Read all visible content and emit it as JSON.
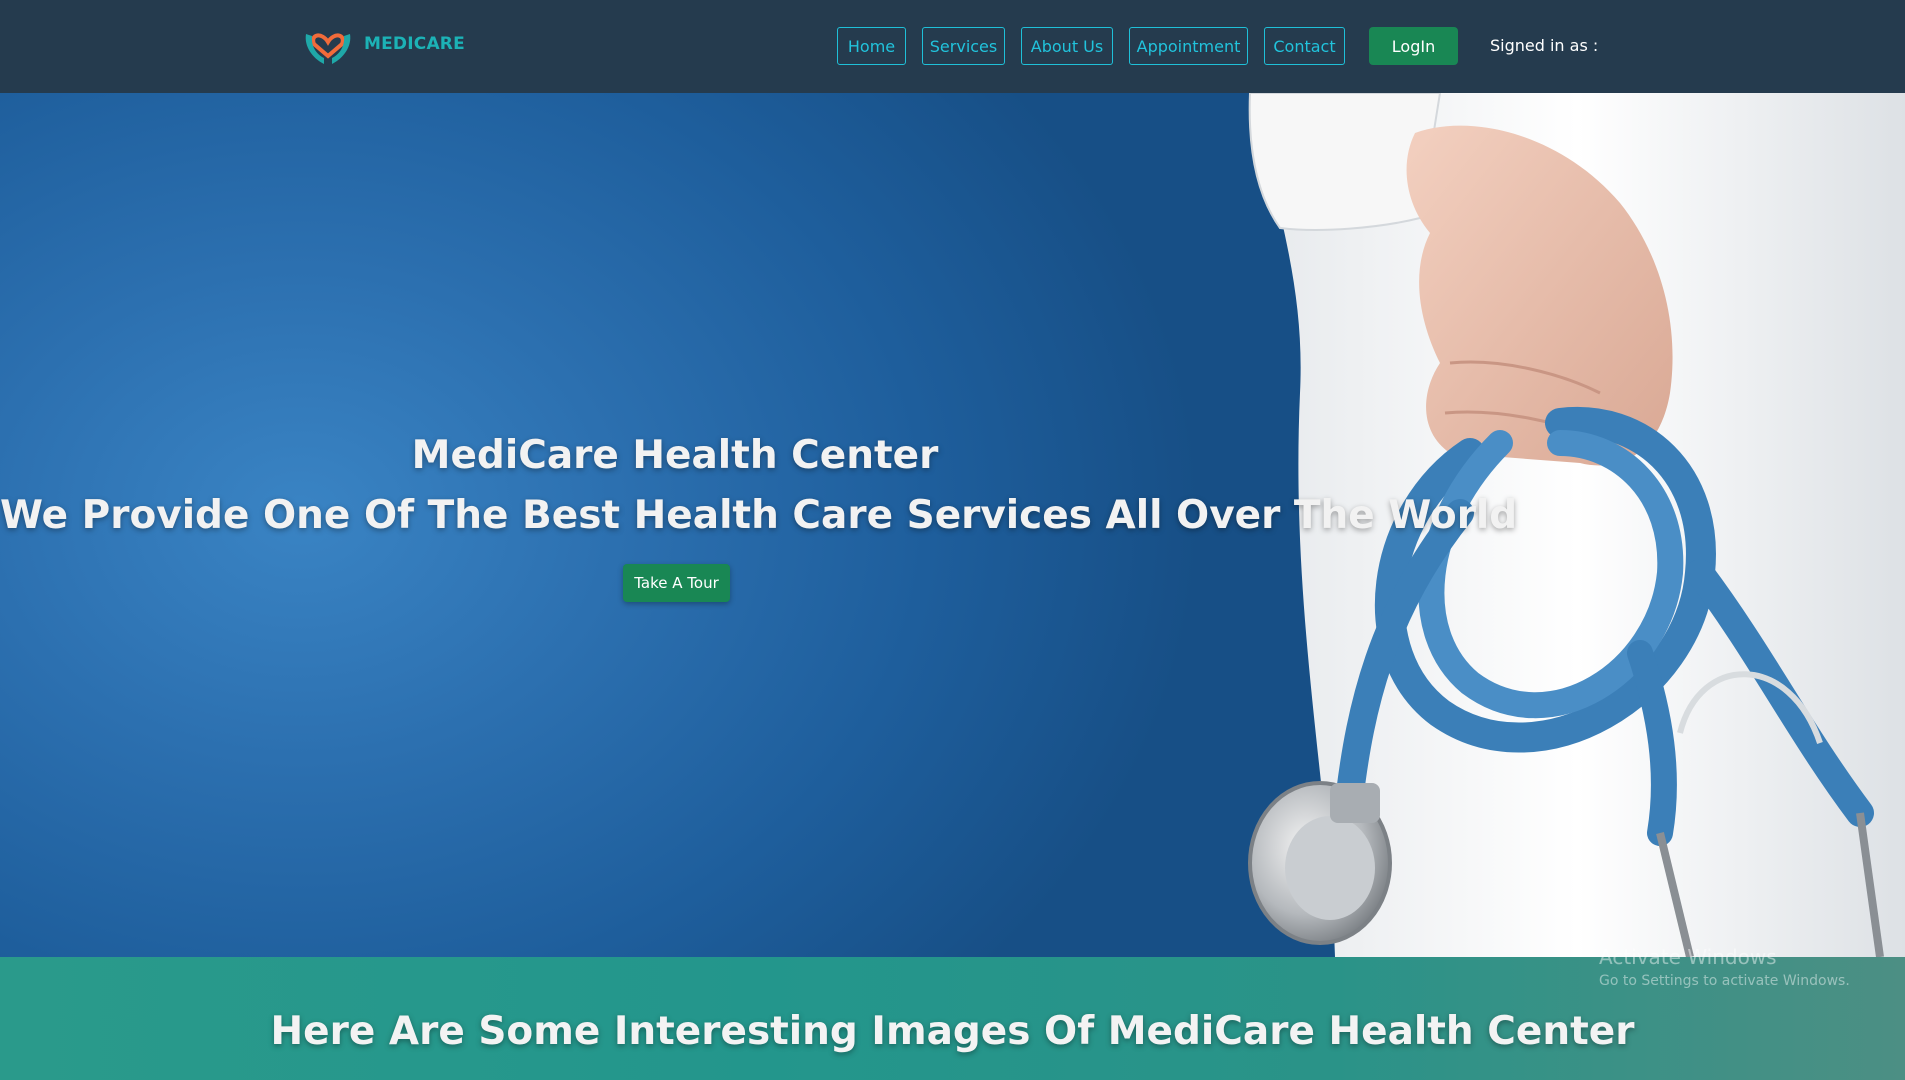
{
  "brand": {
    "name": "MEDICARE",
    "accent_color": "#1cb2b6",
    "logo_heart_color": "#f26b3a",
    "logo_hands_color": "#1fa8a8"
  },
  "nav": {
    "items": [
      {
        "label": "Home"
      },
      {
        "label": "Services"
      },
      {
        "label": "About Us"
      },
      {
        "label": "Appointment"
      },
      {
        "label": "Contact"
      }
    ],
    "login_label": "LogIn",
    "signed_in_label": "Signed in as :"
  },
  "hero": {
    "title": "MediCare Health Center",
    "subtitle": "We Provide One Of The Best Health Care Services All Over The World",
    "cta_label": "Take A Tour"
  },
  "gallery": {
    "heading": "Here Are Some Interesting Images Of MediCare Health Center"
  },
  "watermark": {
    "title": "Activate Windows",
    "subtitle": "Go to Settings to activate Windows."
  },
  "colors": {
    "navbar_bg": "#253b4e",
    "nav_link": "#21c3dc",
    "button_green": "#198754",
    "hero_blue": "#2c70b0",
    "band_teal": "#23968c"
  }
}
